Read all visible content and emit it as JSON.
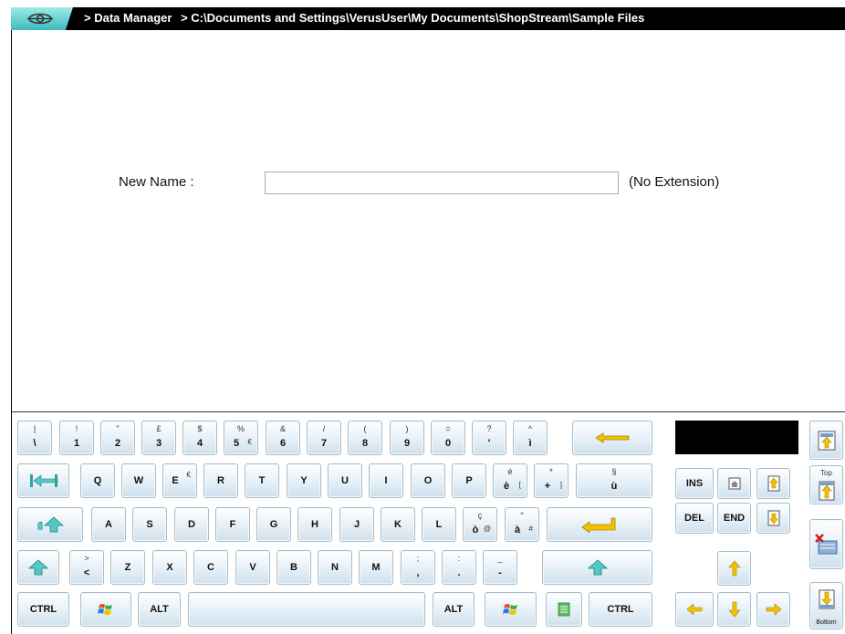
{
  "titlebar": {
    "crumbs": [
      "> Data Manager",
      "> C:\\Documents and Settings\\VerusUser\\My Documents\\ShopStream\\Sample Files"
    ]
  },
  "form": {
    "label": "New Name :",
    "value": "",
    "note": "(No Extension)"
  },
  "keyboard": {
    "row1": [
      {
        "top": "|",
        "main": "\\"
      },
      {
        "top": "!",
        "main": "1"
      },
      {
        "top": "\"",
        "main": "2"
      },
      {
        "top": "£",
        "main": "3"
      },
      {
        "top": "$",
        "main": "4"
      },
      {
        "top": "%",
        "main": "5",
        "sub": "€"
      },
      {
        "top": "&",
        "main": "6"
      },
      {
        "top": "/",
        "main": "7"
      },
      {
        "top": "(",
        "main": "8"
      },
      {
        "top": ")",
        "main": "9"
      },
      {
        "top": "=",
        "main": "0"
      },
      {
        "top": "?",
        "main": "'"
      },
      {
        "top": "^",
        "main": "ì"
      }
    ],
    "row2": [
      {
        "main": "Q"
      },
      {
        "main": "W"
      },
      {
        "main": "E",
        "sub": "€"
      },
      {
        "main": "R"
      },
      {
        "main": "T"
      },
      {
        "main": "Y"
      },
      {
        "main": "U"
      },
      {
        "main": "I"
      },
      {
        "main": "O"
      },
      {
        "main": "P"
      },
      {
        "top": "é",
        "main": "è",
        "sub": "["
      },
      {
        "top": "*",
        "main": "+",
        "sub": "]"
      },
      {
        "top": "§",
        "main": "ù"
      }
    ],
    "row3": [
      {
        "main": "A"
      },
      {
        "main": "S"
      },
      {
        "main": "D"
      },
      {
        "main": "F"
      },
      {
        "main": "G"
      },
      {
        "main": "H"
      },
      {
        "main": "J"
      },
      {
        "main": "K"
      },
      {
        "main": "L"
      },
      {
        "top": "ç",
        "main": "ò",
        "sub": "@"
      },
      {
        "top": "°",
        "main": "à",
        "sub": "#"
      }
    ],
    "row4": [
      {
        "top": ">",
        "main": "<"
      },
      {
        "main": "Z"
      },
      {
        "main": "X"
      },
      {
        "main": "C"
      },
      {
        "main": "V"
      },
      {
        "main": "B"
      },
      {
        "main": "N"
      },
      {
        "main": "M"
      },
      {
        "top": ";",
        "main": ","
      },
      {
        "top": ":",
        "main": "."
      },
      {
        "top": "_",
        "main": "-"
      }
    ],
    "ctrl_left": "CTRL",
    "alt_left": "ALT",
    "alt_right": "ALT",
    "ctrl_right": "CTRL",
    "ins": "INS",
    "del": "DEL",
    "end": "END",
    "top_label": "Top",
    "bottom_label": "Bottom"
  },
  "icons": {
    "accent": "#f2c200",
    "key_face": "#e3eef6",
    "titlebar_bg": "#000000",
    "logo_bg": "#6ad2d2"
  }
}
